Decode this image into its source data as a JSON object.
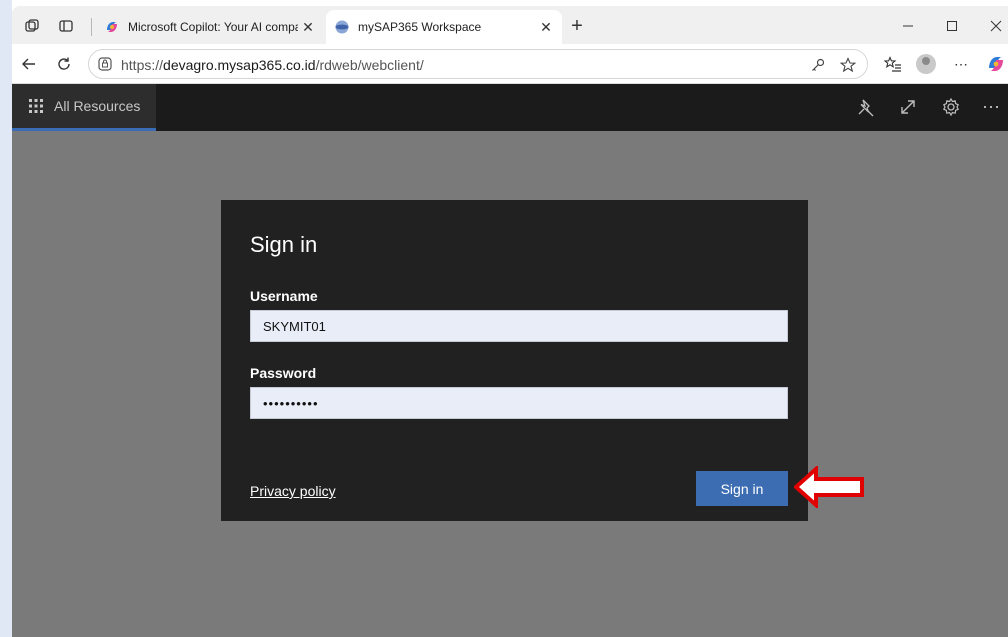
{
  "browser": {
    "tabs": [
      {
        "title": "Microsoft Copilot: Your AI companion",
        "active": false,
        "icon": "copilot-icon"
      },
      {
        "title": "mySAP365 Workspace",
        "active": true,
        "icon": "globe-icon"
      }
    ],
    "new_tab_label": "+",
    "address": {
      "scheme": "https://",
      "host": "devagro.mysap365.co.id",
      "path": "/rdweb/webclient/"
    }
  },
  "rd_header": {
    "tab_label": "All Resources"
  },
  "signin": {
    "title": "Sign in",
    "username_label": "Username",
    "username_value": "SKYMIT01",
    "password_label": "Password",
    "password_value": "••••••••••",
    "privacy_link": "Privacy policy",
    "submit_label": "Sign in"
  },
  "colors": {
    "page_overlay": "#7a7a7a",
    "dialog_bg": "#212121",
    "button_blue": "#3c6db3",
    "input_bg": "#e8edf8",
    "callout_red": "#e00000"
  }
}
